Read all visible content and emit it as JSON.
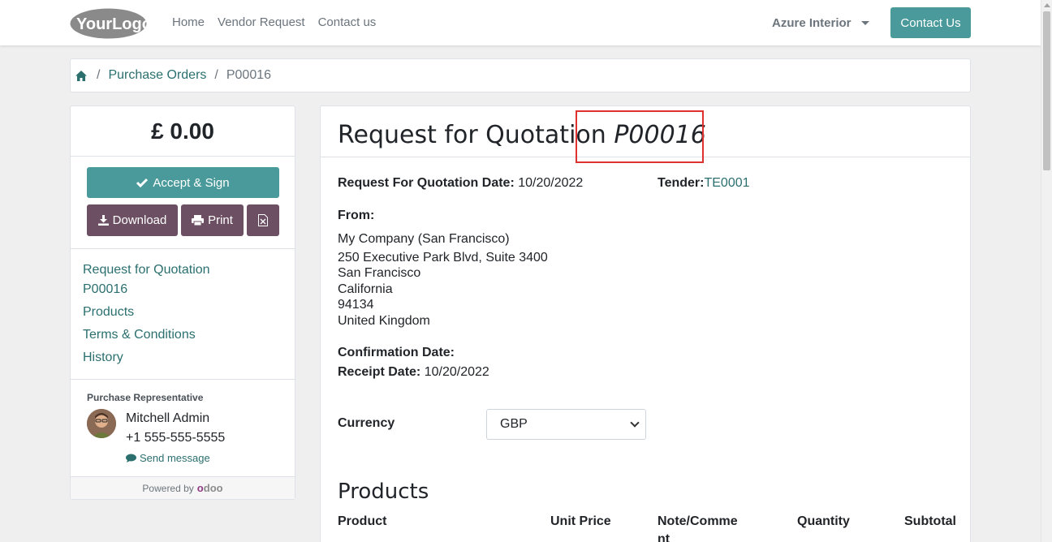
{
  "header": {
    "logo_text": "YourLogo",
    "nav": [
      "Home",
      "Vendor Request",
      "Contact us"
    ],
    "company": "Azure Interior",
    "contact_button": "Contact Us"
  },
  "breadcrumb": {
    "items": [
      "Purchase Orders",
      "P00016"
    ],
    "separator": "/"
  },
  "sidebar": {
    "total": "£ 0.00",
    "accept_label": "Accept & Sign",
    "download_label": "Download",
    "print_label": "Print",
    "toc": [
      "Request for Quotation",
      "P00016",
      "Products",
      "Terms & Conditions",
      "History"
    ],
    "rep_label": "Purchase Representative",
    "rep_name": "Mitchell Admin",
    "rep_phone": "+1 555-555-5555",
    "send_message": "Send message",
    "powered_by": "Powered by",
    "powered_brand": "odoo"
  },
  "document": {
    "title": "Request for Quotation",
    "number": "P00016",
    "rfq_date_label": "Request For Quotation Date:",
    "rfq_date": "10/20/2022",
    "tender_label": "Tender:",
    "tender_value": "TE0001",
    "from_label": "From:",
    "address": [
      "My Company (San Francisco)",
      "250 Executive Park Blvd, Suite 3400",
      "San Francisco",
      "California",
      "94134",
      "United Kingdom"
    ],
    "confirmation_label": "Confirmation Date:",
    "receipt_label": "Receipt Date:",
    "receipt_date": "10/20/2022",
    "currency_label": "Currency",
    "currency_value": "GBP",
    "products_heading": "Products",
    "columns": [
      "Product",
      "Unit Price",
      "Note/Comme nt",
      "Quantity",
      "Subtotal"
    ]
  },
  "colors": {
    "accent": "#4a9a9b",
    "secondary": "#6c4f62",
    "link": "#2b6f6f",
    "highlight": "#e03131"
  }
}
